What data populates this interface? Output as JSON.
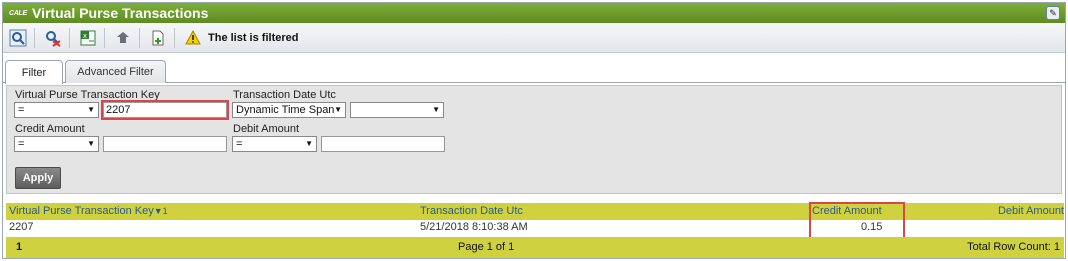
{
  "window": {
    "logo_text": "CALE",
    "title": "Virtual Purse Transactions",
    "right_icon": "pin-icon"
  },
  "toolbar": {
    "filtered_message": "The list is filtered",
    "buttons": [
      "search-icon",
      "clear-filter-icon",
      "export-excel-icon",
      "actions-icon",
      "new-document-icon",
      "warning-icon"
    ]
  },
  "tabs": [
    {
      "label": "Filter",
      "active": true
    },
    {
      "label": "Advanced Filter",
      "active": false
    }
  ],
  "filter": {
    "vpt_key": {
      "label": "Virtual Purse Transaction Key",
      "operator": "=",
      "value": "2207"
    },
    "transaction_date": {
      "label": "Transaction Date Utc",
      "mode": "Dynamic Time Span",
      "value": ""
    },
    "credit_amount": {
      "label": "Credit Amount",
      "operator": "=",
      "value": ""
    },
    "debit_amount": {
      "label": "Debit Amount",
      "operator": "=",
      "value": ""
    },
    "apply_label": "Apply"
  },
  "grid": {
    "columns": [
      {
        "label": "Virtual Purse Transaction Key",
        "sort_indicator": "▼1"
      },
      {
        "label": "Transaction Date Utc"
      },
      {
        "label": "Credit Amount"
      },
      {
        "label": "Debit Amount"
      }
    ],
    "rows": [
      [
        "2207",
        "5/21/2018 8:10:38 AM",
        "0.15",
        ""
      ]
    ],
    "footer": {
      "page_number": "1",
      "page_info": "Page 1 of 1",
      "total_count": "Total Row Count: 1"
    }
  },
  "colors": {
    "title_bar": "#6a9a2c",
    "grid_header": "#cfd23e",
    "highlight": "#d9464a",
    "link": "#2b5a8a"
  }
}
